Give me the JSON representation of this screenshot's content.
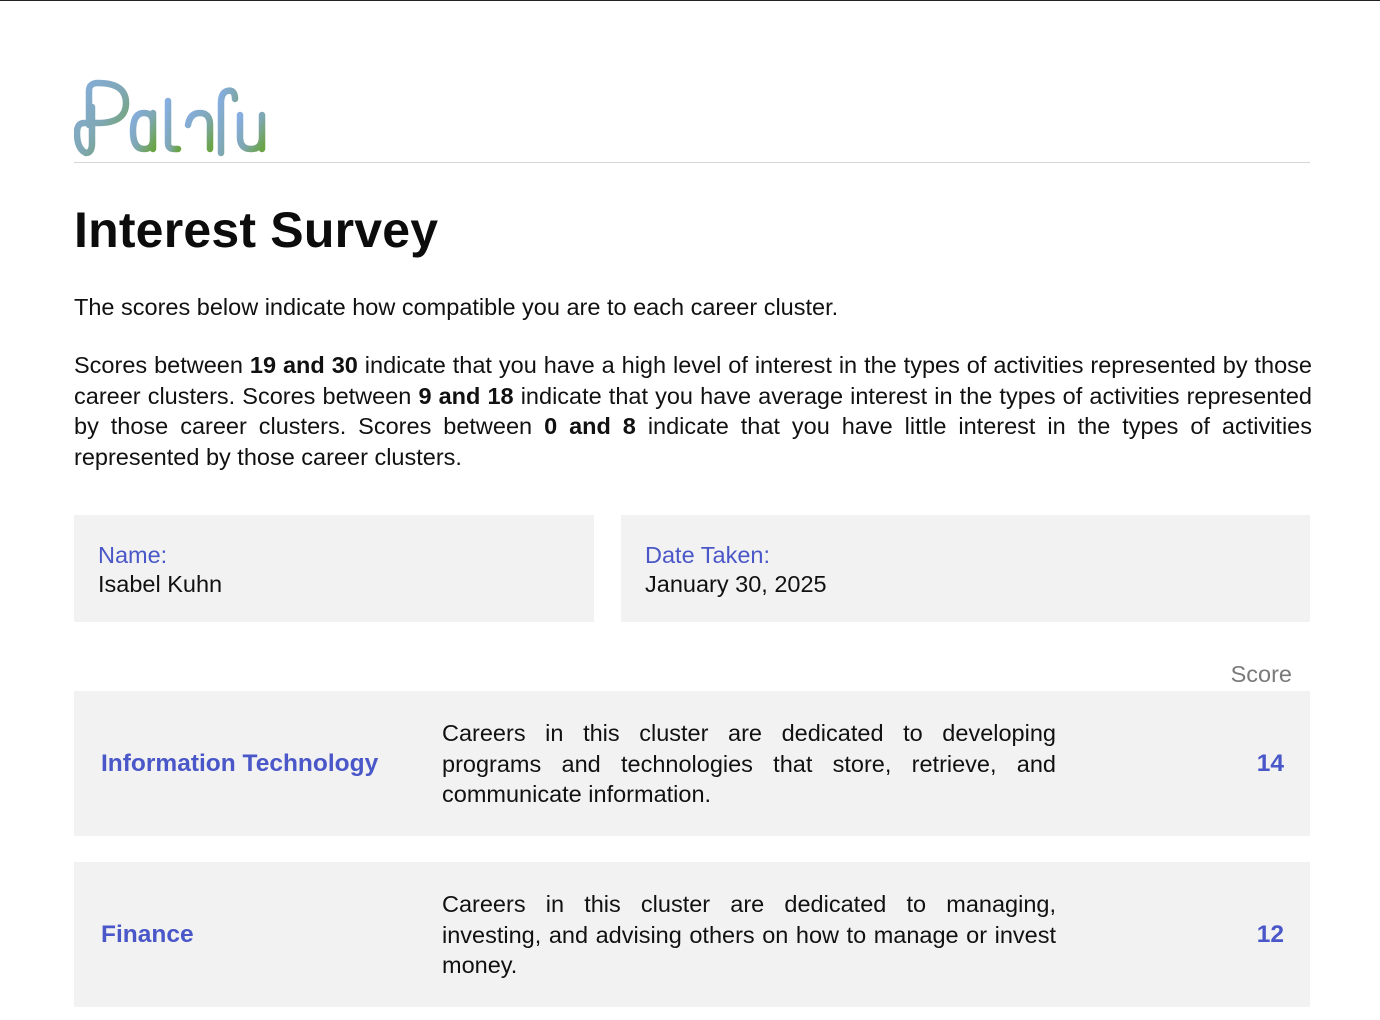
{
  "brand": {
    "logo_text": "Pathful",
    "logo_color_start": "#7ea3d6",
    "logo_color_end": "#6aa34a"
  },
  "survey": {
    "title": "Interest Survey",
    "intro": "The scores below indicate how compatible you are to each career cluster.",
    "legend": {
      "t1": "Scores between ",
      "high": "19 and 30",
      "t2": " indicate that you have a high level of interest in the types of activities represented by those career clusters. Scores between ",
      "avg": "9 and 18",
      "t3": " indicate that you have average interest in the types of activities represented by those career clusters. Scores between ",
      "low": "0 and 8",
      "t4": " indicate that you have little interest in the types of activities represented by those career clusters."
    }
  },
  "info": {
    "name_label": "Name:",
    "name_value": "Isabel Kuhn",
    "date_label": "Date Taken:",
    "date_value": "January 30, 2025"
  },
  "score_header": "Score",
  "clusters": [
    {
      "name": "Information Technology",
      "description": "Careers in this cluster are dedicated to developing programs and technologies that store, retrieve, and communicate information.",
      "score": "14"
    },
    {
      "name": "Finance",
      "description": "Careers in this cluster are dedicated to managing, investing, and advising others on how to manage or invest money.",
      "score": "12"
    }
  ],
  "colors": {
    "accent": "#4a57c8",
    "panel": "#f2f2f2"
  }
}
